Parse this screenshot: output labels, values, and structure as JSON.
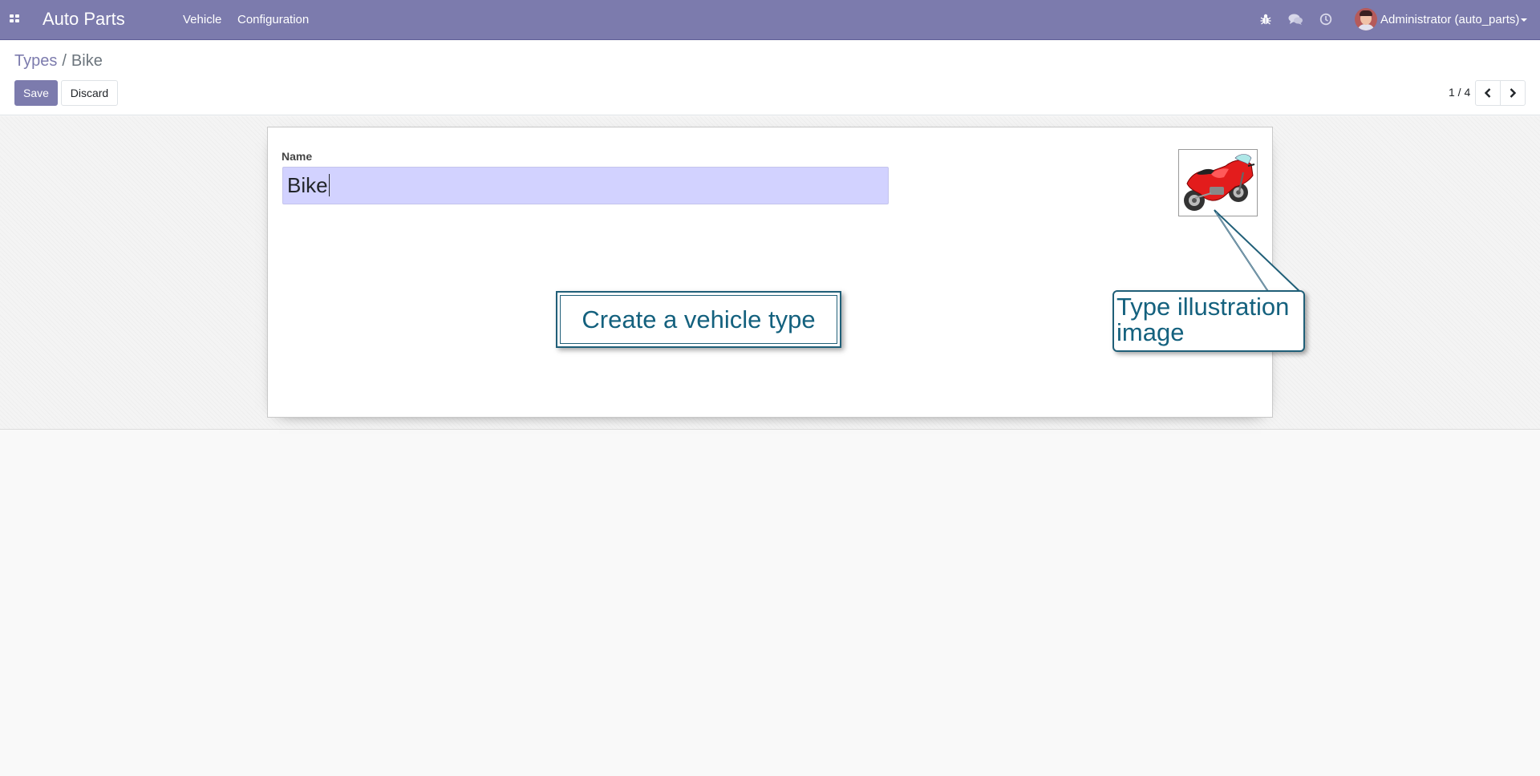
{
  "navbar": {
    "brand": "Auto Parts",
    "menu": [
      {
        "label": "Vehicle"
      },
      {
        "label": "Configuration"
      }
    ],
    "icons": [
      "apps-icon",
      "bug-icon",
      "chat-icon",
      "clock-icon",
      "caret-down-icon"
    ],
    "user": "Administrator (auto_parts)",
    "color": "#7c7bad"
  },
  "breadcrumb": {
    "parent": "Types",
    "separator": "/",
    "current": "Bike"
  },
  "buttons": {
    "save": "Save",
    "discard": "Discard"
  },
  "pager": {
    "value": "1 / 4"
  },
  "form": {
    "name_label": "Name",
    "name_value": "Bike",
    "image_alt": "motorbike illustration"
  },
  "tooltips": {
    "main": "Create a vehicle type",
    "image_line1": "Type illustration",
    "image_line2": "image"
  }
}
